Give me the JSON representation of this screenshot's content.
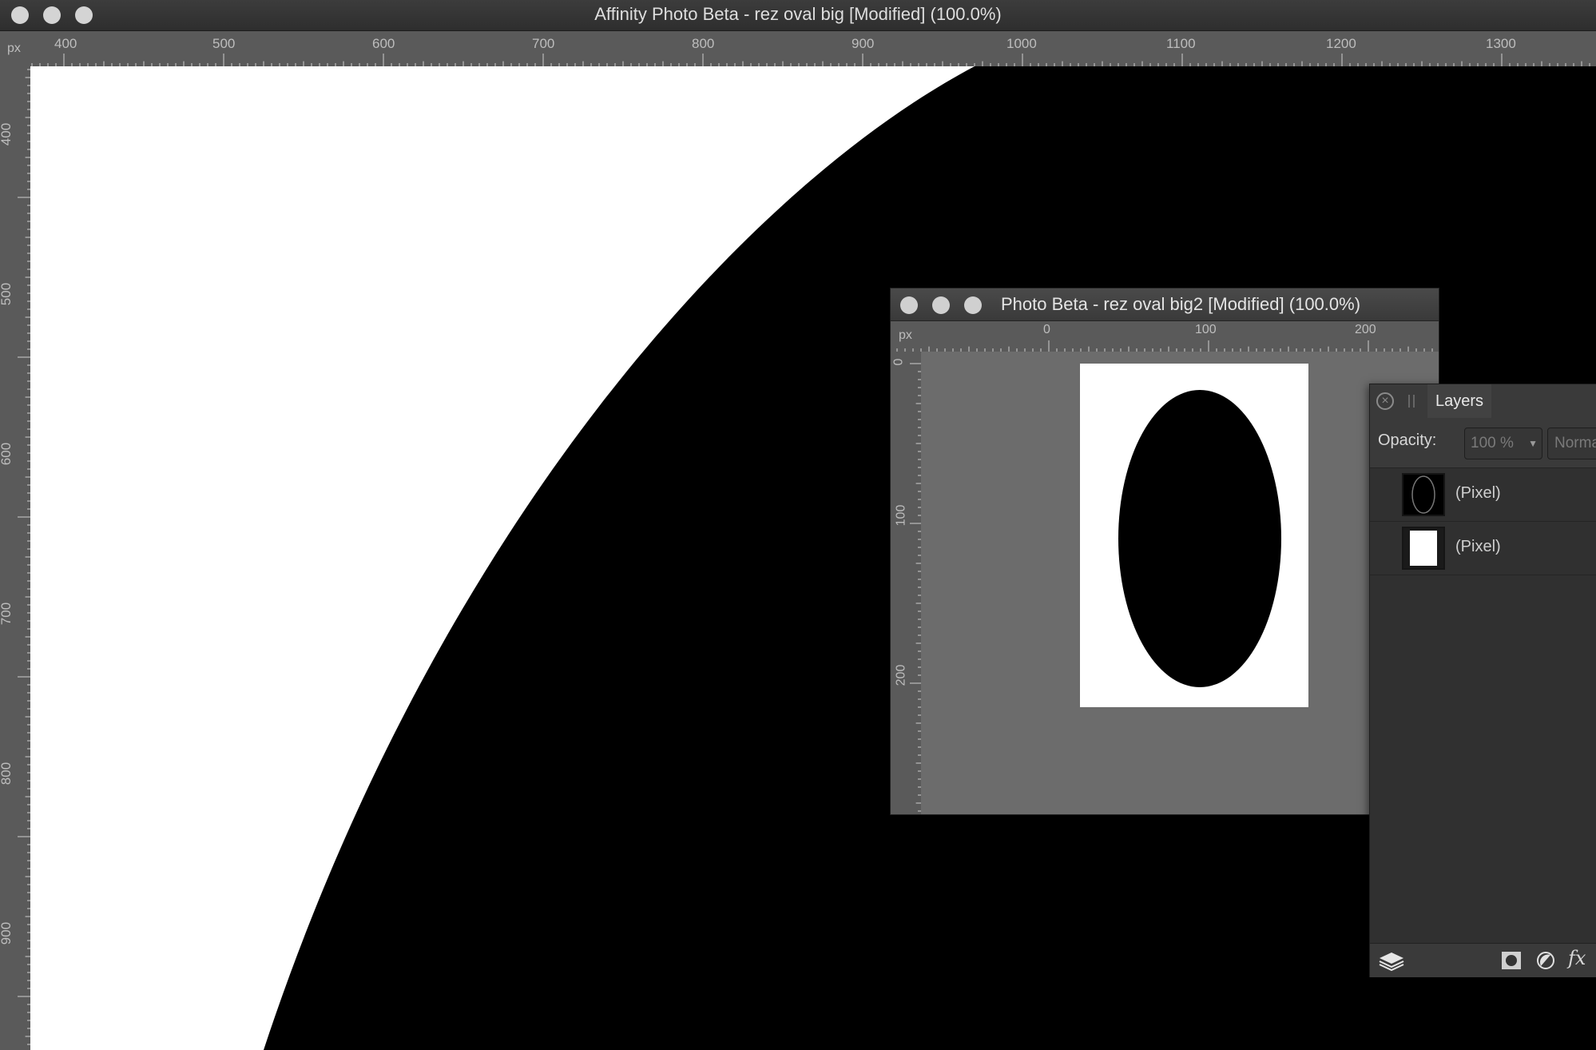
{
  "main_window": {
    "title": "Affinity Photo Beta - rez oval big [Modified] (100.0%)",
    "ruler_unit": "px",
    "top_ruler_labels": [
      "400",
      "500",
      "600",
      "700",
      "800",
      "900",
      "1000",
      "1100",
      "1200",
      "1300"
    ],
    "left_ruler_labels": [
      "400",
      "500",
      "600",
      "700",
      "800",
      "900"
    ]
  },
  "doc2_window": {
    "title": "Photo Beta - rez oval big2 [Modified] (100.0%)",
    "ruler_unit": "px",
    "top_ruler_labels": [
      "0",
      "100",
      "200"
    ],
    "left_ruler_labels": [
      "0",
      "100",
      "200"
    ]
  },
  "layers_panel": {
    "tab_label": "Layers",
    "opacity_label": "Opacity:",
    "opacity_value": "100 %",
    "blend_mode": "Normal",
    "layers": [
      {
        "name": "(Pixel)",
        "thumb": "oval-thumbnail"
      },
      {
        "name": "(Pixel)",
        "thumb": "white-rect-thumbnail"
      }
    ],
    "footer_icons": [
      "layers-stack-icon",
      "mask-icon",
      "adjustment-icon",
      "fx-icon"
    ]
  },
  "colors": {
    "canvas_black": "#000000",
    "canvas_white": "#ffffff",
    "ruler_bg": "#5a5a5a",
    "panel_bg": "#303030"
  }
}
